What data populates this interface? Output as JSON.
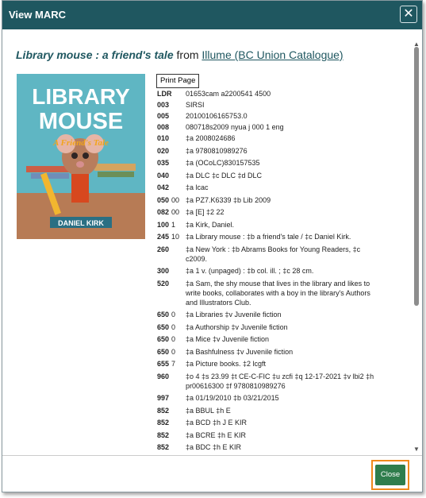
{
  "dialog": {
    "title": "View MARC",
    "close_icon": "✕"
  },
  "heading": {
    "book_title": "Library mouse : a friend's tale",
    "from": "from",
    "source_link": "Illume (BC Union Catalogue)"
  },
  "cover": {
    "title_line1": "LIBRARY",
    "title_line2": "MOUSE",
    "subtitle": "A Friend's Tale",
    "author": "DANIEL KIRK",
    "colors": {
      "background": "#5fb6c3",
      "title": "#ffffff",
      "accent": "#f2a51d"
    }
  },
  "print_button": "Print Page",
  "marc_records": [
    {
      "tag": "LDR",
      "ind": "",
      "value": "01653cam a2200541 4500"
    },
    {
      "tag": "003",
      "ind": "",
      "value": "SIRSI"
    },
    {
      "tag": "005",
      "ind": "",
      "value": "20100106165753.0"
    },
    {
      "tag": "008",
      "ind": "",
      "value": "080718s2009 nyua j 000 1 eng"
    },
    {
      "tag": "010",
      "ind": "",
      "value": "‡a 2008024686"
    },
    {
      "tag": "020",
      "ind": "",
      "value": "‡a 9780810989276"
    },
    {
      "tag": "035",
      "ind": "",
      "value": "‡a (OCoLC)830157535"
    },
    {
      "tag": "040",
      "ind": "",
      "value": "‡a DLC ‡c DLC ‡d DLC"
    },
    {
      "tag": "042",
      "ind": "",
      "value": "‡a lcac"
    },
    {
      "tag": "050",
      "ind": "00",
      "value": "‡a PZ7.K6339 ‡b Lib 2009"
    },
    {
      "tag": "082",
      "ind": "00",
      "value": "‡a [E] ‡2 22"
    },
    {
      "tag": "100",
      "ind": "1",
      "value": "‡a Kirk, Daniel."
    },
    {
      "tag": "245",
      "ind": "10",
      "value": "‡a Library mouse : ‡b a friend's tale / ‡c Daniel Kirk."
    },
    {
      "tag": "260",
      "ind": "",
      "value": "‡a New York : ‡b Abrams Books for Young Readers, ‡c c2009."
    },
    {
      "tag": "300",
      "ind": "",
      "value": "‡a 1 v. (unpaged) : ‡b col. ill. ; ‡c 28 cm."
    },
    {
      "tag": "520",
      "ind": "",
      "value": "‡a Sam, the shy mouse that lives in the library and likes to write books, collaborates with a boy in the library's Authors and Illustrators Club."
    },
    {
      "tag": "650",
      "ind": "0",
      "value": "‡a Libraries ‡v Juvenile fiction"
    },
    {
      "tag": "650",
      "ind": "0",
      "value": "‡a Authorship ‡v Juvenile fiction"
    },
    {
      "tag": "650",
      "ind": "0",
      "value": "‡a Mice ‡v Juvenile fiction"
    },
    {
      "tag": "650",
      "ind": "0",
      "value": "‡a Bashfulness ‡v Juvenile fiction"
    },
    {
      "tag": "655",
      "ind": "7",
      "value": "‡a Picture books. ‡2 lcgft"
    },
    {
      "tag": "960",
      "ind": "",
      "value": "‡o 4 ‡s 23.99 ‡t CE-C-FIC ‡u zcfi ‡q 12-17-2021 ‡v lbi2 ‡h pr00616300 ‡f 9780810989276"
    },
    {
      "tag": "997",
      "ind": "",
      "value": "‡a 01/19/2010 ‡b 03/21/2015"
    },
    {
      "tag": "852",
      "ind": "",
      "value": "‡a BBUL ‡h E"
    },
    {
      "tag": "852",
      "ind": "",
      "value": "‡a BCD ‡h J E KIR"
    },
    {
      "tag": "852",
      "ind": "",
      "value": "‡a BCRE ‡h E KIR"
    },
    {
      "tag": "852",
      "ind": "",
      "value": "‡a BDC ‡h E KIR"
    }
  ],
  "footer": {
    "close_label": "Close"
  }
}
